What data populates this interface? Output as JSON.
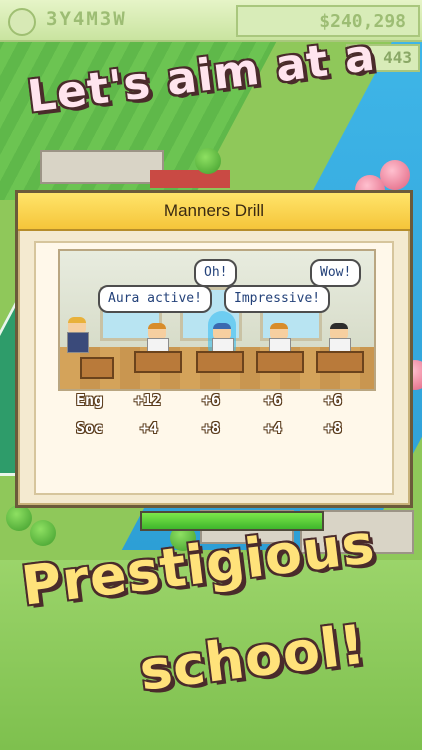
{
  "hud": {
    "date": "3Y4M3W",
    "money": "$240,298",
    "sub_value": "443"
  },
  "promo": {
    "line1": "Let's aim at a",
    "line2": "Prestigious",
    "line3": "school!"
  },
  "dialog": {
    "title": "Manners Drill",
    "bubbles": [
      "Aura active!",
      "Oh!",
      "Impressive!",
      "Wow!"
    ],
    "stats": {
      "rows": [
        {
          "label": "Eng",
          "values": [
            "+12",
            "+6",
            "+6",
            "+6"
          ]
        },
        {
          "label": "Soc",
          "values": [
            "+4",
            "+8",
            "+4",
            "+8"
          ]
        }
      ]
    },
    "progress": 1.0
  },
  "colors": {
    "title_bar": "#f5c53a",
    "progress": "#3fb62c",
    "promo_top": "#ffe4ee",
    "promo_bottom": "#ffe27a"
  }
}
